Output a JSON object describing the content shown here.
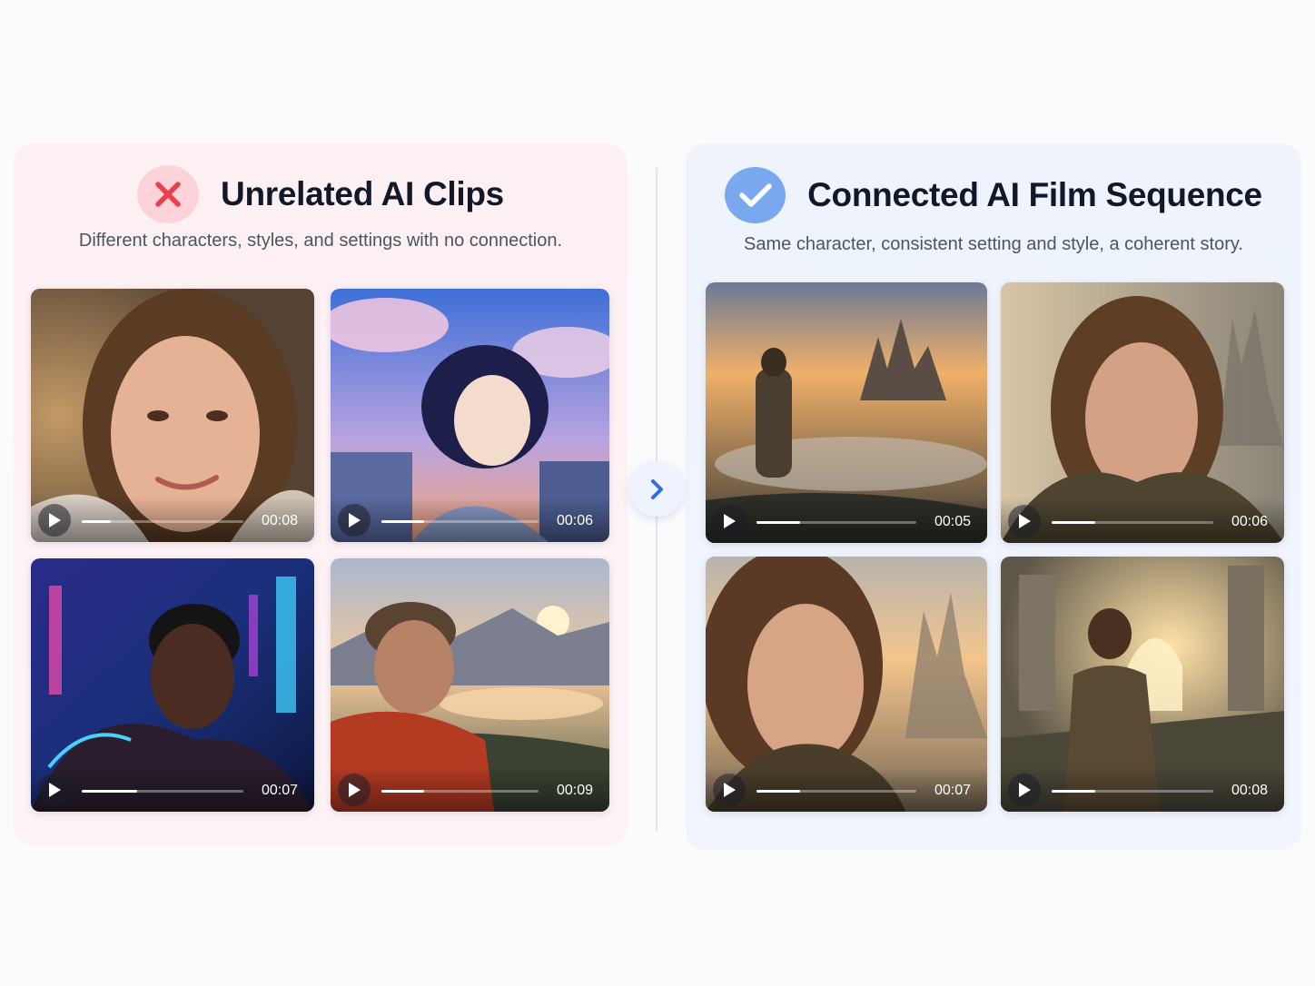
{
  "left_panel": {
    "icon": "x-icon",
    "title": "Unrelated AI Clips",
    "subtitle": "Different characters, styles, and settings with no connection.",
    "accent": "#e5424d",
    "clips": [
      {
        "scene": "portrait-woman-selfie",
        "duration": "00:08",
        "progress": 0.18
      },
      {
        "scene": "anime-girl-sky",
        "duration": "00:06",
        "progress": 0.27
      },
      {
        "scene": "cyberpunk-man-neon",
        "duration": "00:07",
        "progress": 0.34
      },
      {
        "scene": "hiker-mountain-lake",
        "duration": "00:09",
        "progress": 0.27
      }
    ]
  },
  "right_panel": {
    "icon": "check-icon",
    "title": "Connected AI Film Sequence",
    "subtitle": "Same character, consistent setting and style, a coherent story.",
    "accent": "#7aa8ee",
    "clips": [
      {
        "scene": "traveler-overlooking-castle",
        "duration": "00:05",
        "progress": 0.27
      },
      {
        "scene": "traveler-closeup-castle",
        "duration": "00:06",
        "progress": 0.27
      },
      {
        "scene": "traveler-profile-sunset",
        "duration": "00:07",
        "progress": 0.27
      },
      {
        "scene": "traveler-ruins-stairs",
        "duration": "00:08",
        "progress": 0.27
      }
    ]
  },
  "arrow": {
    "icon": "chevron-right-icon",
    "color": "#2f6fe0"
  }
}
